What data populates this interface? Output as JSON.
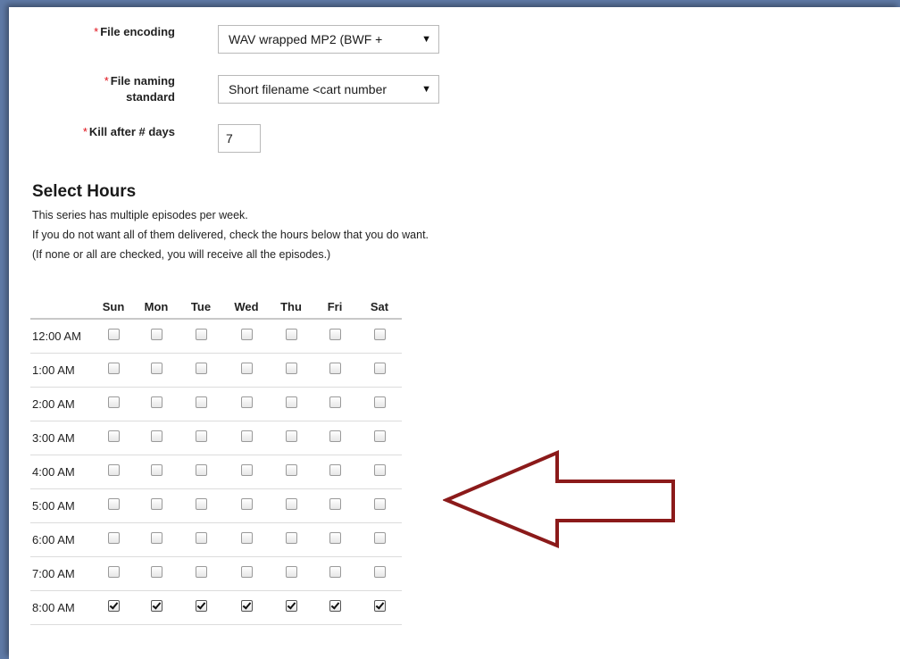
{
  "form": {
    "required_mark": "*",
    "file_encoding": {
      "label": "File encoding",
      "value": "WAV wrapped MP2 (BWF +"
    },
    "file_naming": {
      "label_line1": "File naming",
      "label_line2": "standard",
      "value": "Short filename <cart number"
    },
    "kill_days": {
      "label": "Kill after # days",
      "value": "7"
    }
  },
  "select_hours": {
    "title": "Select Hours",
    "desc_lines": [
      "This series has multiple episodes per week.",
      "If you do not want all of them delivered, check the hours below that you do want.",
      "(If none or all are checked, you will receive all the episodes.)"
    ],
    "days": [
      "Sun",
      "Mon",
      "Tue",
      "Wed",
      "Thu",
      "Fri",
      "Sat"
    ],
    "rows": [
      {
        "time": "12:00 AM",
        "checked": false
      },
      {
        "time": "1:00 AM",
        "checked": false
      },
      {
        "time": "2:00 AM",
        "checked": false
      },
      {
        "time": "3:00 AM",
        "checked": false
      },
      {
        "time": "4:00 AM",
        "checked": false
      },
      {
        "time": "5:00 AM",
        "checked": false
      },
      {
        "time": "6:00 AM",
        "checked": false
      },
      {
        "time": "7:00 AM",
        "checked": false
      },
      {
        "time": "8:00 AM",
        "checked": true
      }
    ]
  },
  "colors": {
    "required": "#e0101a",
    "arrow": "#8b1a1a",
    "page_background": "#5f7aa6"
  },
  "icons": {
    "dropdown": "chevron-down-icon",
    "annotation": "left-arrow-icon"
  }
}
